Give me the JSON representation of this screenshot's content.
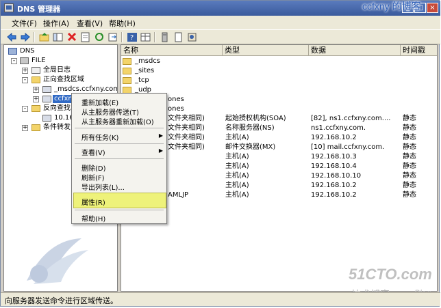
{
  "window": {
    "title": "DNS 管理器"
  },
  "watermark_top": "ccfxny 的博客",
  "menubar": [
    {
      "label": "文件(F)"
    },
    {
      "label": "操作(A)"
    },
    {
      "label": "查看(V)"
    },
    {
      "label": "帮助(H)"
    }
  ],
  "tree": {
    "root": "DNS",
    "server": "FILE",
    "global_log": "全局日志",
    "forward_zones": "正向查找区域",
    "msdcs_zone": "_msdcs.ccfxny.com",
    "ccfxny_zone": "ccfxny",
    "reverse_zones": "反向查找",
    "reverse_item": "10.16",
    "forwarders": "条件转发"
  },
  "list": {
    "columns": [
      "名称",
      "类型",
      "数据",
      "时间戳"
    ],
    "rows": [
      {
        "name": "_msdcs",
        "type": "",
        "data": "",
        "ts": ""
      },
      {
        "name": "_sites",
        "type": "",
        "data": "",
        "ts": ""
      },
      {
        "name": "_tcp",
        "type": "",
        "data": "",
        "ts": ""
      },
      {
        "name": "_udp",
        "type": "",
        "data": "",
        "ts": ""
      },
      {
        "name": "ones",
        "type": "",
        "data": "",
        "ts": ""
      },
      {
        "name": "ones",
        "type": "",
        "data": "",
        "ts": ""
      },
      {
        "name": "文件夹相同)",
        "type": "起始授权机构(SOA)",
        "data": "[82], ns1.ccfxny.com....",
        "ts": "静态"
      },
      {
        "name": "文件夹相同)",
        "type": "名称服务器(NS)",
        "data": "ns1.ccfxny.com.",
        "ts": "静态"
      },
      {
        "name": "文件夹相同)",
        "type": "主机(A)",
        "data": "192.168.10.2",
        "ts": "静态"
      },
      {
        "name": "文件夹相同)",
        "type": "邮件交换器(MX)",
        "data": "[10]  mail.ccfxny.com.",
        "ts": "静态"
      },
      {
        "name": "",
        "type": "主机(A)",
        "data": "192.168.10.3",
        "ts": "静态"
      },
      {
        "name": "",
        "type": "主机(A)",
        "data": "192.168.10.4",
        "ts": "静态"
      },
      {
        "name": "",
        "type": "主机(A)",
        "data": "192.168.10.10",
        "ts": "静态"
      },
      {
        "name": "",
        "type": "主机(A)",
        "data": "192.168.10.2",
        "ts": "静态"
      },
      {
        "name": "AMLJP",
        "type": "主机(A)",
        "data": "192.168.10.2",
        "ts": "静态"
      }
    ]
  },
  "context_menu": {
    "reload": "重新加载(E)",
    "transfer": "从主服务器传送(T)",
    "retransfer": "从主服务器重新加载(O)",
    "all_tasks": "所有任务(K)",
    "view": "查看(V)",
    "delete": "删除(D)",
    "refresh": "刷新(F)",
    "export": "导出列表(L)...",
    "properties": "属性(R)",
    "help": "帮助(H)"
  },
  "statusbar": {
    "text": "向服务器发送命令进行区域传送。"
  },
  "watermarks": {
    "site": "51CTO.com",
    "blog_cn": "技术博客",
    "blog_en": "Blog"
  },
  "colors": {
    "highlight": "#eef27a",
    "titlebar": "#3a5a9c",
    "link": "#2e5fb8"
  }
}
